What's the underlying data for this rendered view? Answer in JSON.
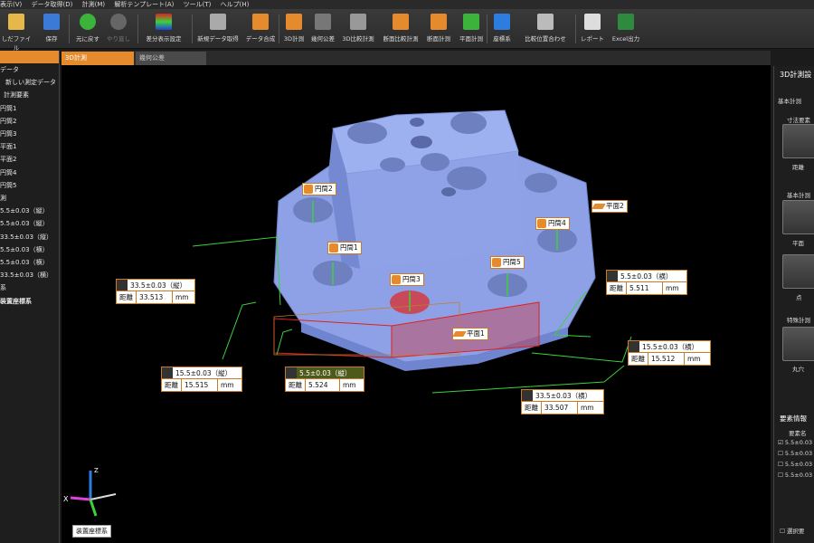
{
  "menu": [
    "表示(V)",
    "データ取得(D)",
    "計測(M)",
    "解析テンプレート(A)",
    "ツール(T)",
    "ヘルプ(H)"
  ],
  "toolbar": {
    "open_file": "しだファイル",
    "save": "保存",
    "undo": "元に戻す",
    "redo": "やり直し",
    "diff_display": "差分表示設定",
    "new_data": "新規データ取得",
    "data_merge": "データ合成",
    "measure_3d": "3D計測",
    "geometric_tolerance": "幾何公差",
    "compare_3d": "3D比較計測",
    "section_compare": "断面比較計測",
    "section_measure": "断面計測",
    "plane_measure": "平面計測",
    "coord_system": "座標系",
    "compare_align": "比較位置合わせ",
    "report": "レポート",
    "excel": "Excel出力"
  },
  "left_tree": [
    "データ",
    "新しい測定データ",
    "計測要素",
    "円筒1",
    "円筒2",
    "円筒3",
    "平面1",
    "平面2",
    "円筒4",
    "円筒5",
    "測",
    "5.5±0.03（縦）",
    "5.5±0.03（縦）",
    "33.5±0.03（縦）",
    "5.5±0.03（横）",
    "5.5±0.03（横）",
    "33.5±0.03（横）",
    "系",
    "装置座標系"
  ],
  "tabs": {
    "active": "3D計測",
    "inactive": "幾何公差"
  },
  "features": {
    "cyl2": "円筒2",
    "cyl1": "円筒1",
    "cyl3": "円筒3",
    "cyl4": "円筒4",
    "cyl5": "円筒5",
    "plane2": "平面2",
    "plane1": "平面1"
  },
  "callouts": {
    "a": {
      "title": "33.5±0.03（縦）",
      "label": "距離",
      "value": "33.513",
      "unit": "mm"
    },
    "b": {
      "title": "15.5±0.03（縦）",
      "label": "距離",
      "value": "15.515",
      "unit": "mm"
    },
    "c": {
      "title": "5.5±0.03（縦）",
      "label": "距離",
      "value": "5.524",
      "unit": "mm"
    },
    "d": {
      "title": "5.5±0.03（横）",
      "label": "距離",
      "value": "5.511",
      "unit": "mm"
    },
    "e": {
      "title": "15.5±0.03（横）",
      "label": "距離",
      "value": "15.512",
      "unit": "mm"
    },
    "f": {
      "title": "33.5±0.03（横）",
      "label": "距離",
      "value": "33.507",
      "unit": "mm"
    }
  },
  "axis_x": "X",
  "axis_z": "Z",
  "coord_label": "装置座標系",
  "right": {
    "title": "3D計測設",
    "basic": "基本計測",
    "dim_elem": "寸法要素",
    "distance": "距離",
    "basic2": "基本計測",
    "plane": "平面",
    "point": "点",
    "special": "特殊計測",
    "round_hole": "丸穴",
    "elem_info": "要素情報",
    "elem_name": "要素名",
    "rows": [
      "5.5±0.03",
      "5.5±0.03",
      "5.5±0.03",
      "5.5±0.03"
    ],
    "select_all": "選択要"
  },
  "colors": {
    "accent": "#e68a2e",
    "model": "#8fa3e8",
    "green": "#3cd23c",
    "red": "#e02020"
  }
}
